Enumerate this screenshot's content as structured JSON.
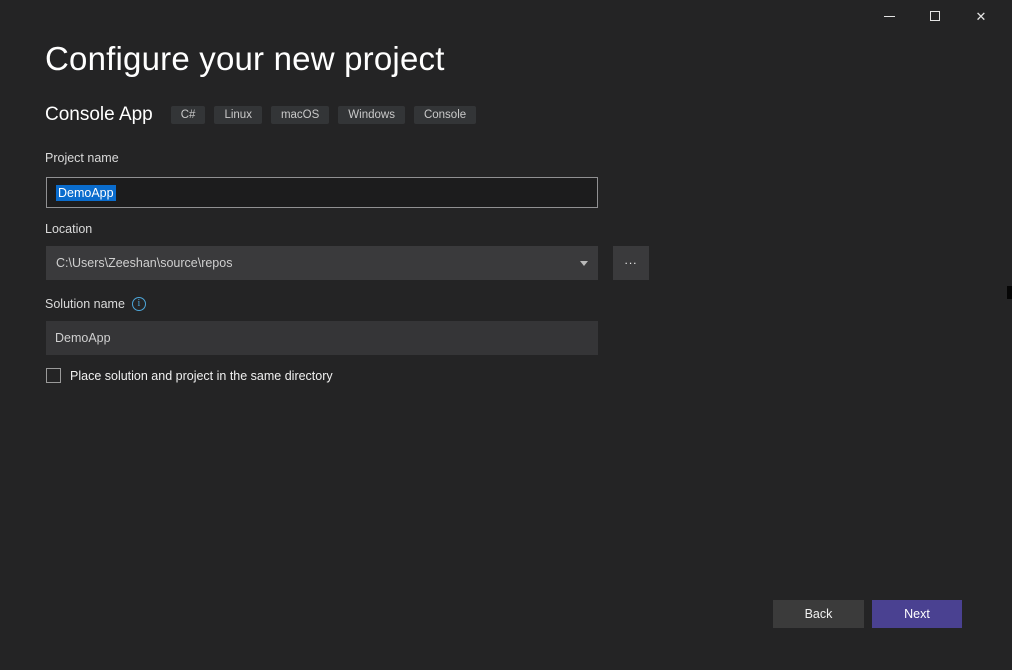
{
  "window": {
    "controls": {
      "minimize": "minimize",
      "maximize": "maximize",
      "close": "✕"
    }
  },
  "header": {
    "title": "Configure your new project"
  },
  "template": {
    "name": "Console App",
    "tags": [
      "C#",
      "Linux",
      "macOS",
      "Windows",
      "Console"
    ]
  },
  "form": {
    "project_name": {
      "label": "Project name",
      "value": "DemoApp",
      "selected": true
    },
    "location": {
      "label": "Location",
      "value": "C:\\Users\\Zeeshan\\source\\repos",
      "browse_label": "..."
    },
    "solution_name": {
      "label": "Solution name",
      "value": "DemoApp"
    },
    "checkbox": {
      "label": "Place solution and project in the same directory",
      "checked": false
    }
  },
  "footer": {
    "back_label": "Back",
    "next_label": "Next"
  },
  "colors": {
    "background": "#242425",
    "field_dark": "#1c1c1d",
    "field_light": "#3a3a3c",
    "selection_blue": "#0a6ccd",
    "accent_purple": "#4a4191",
    "info_icon": "#4da6d9"
  }
}
